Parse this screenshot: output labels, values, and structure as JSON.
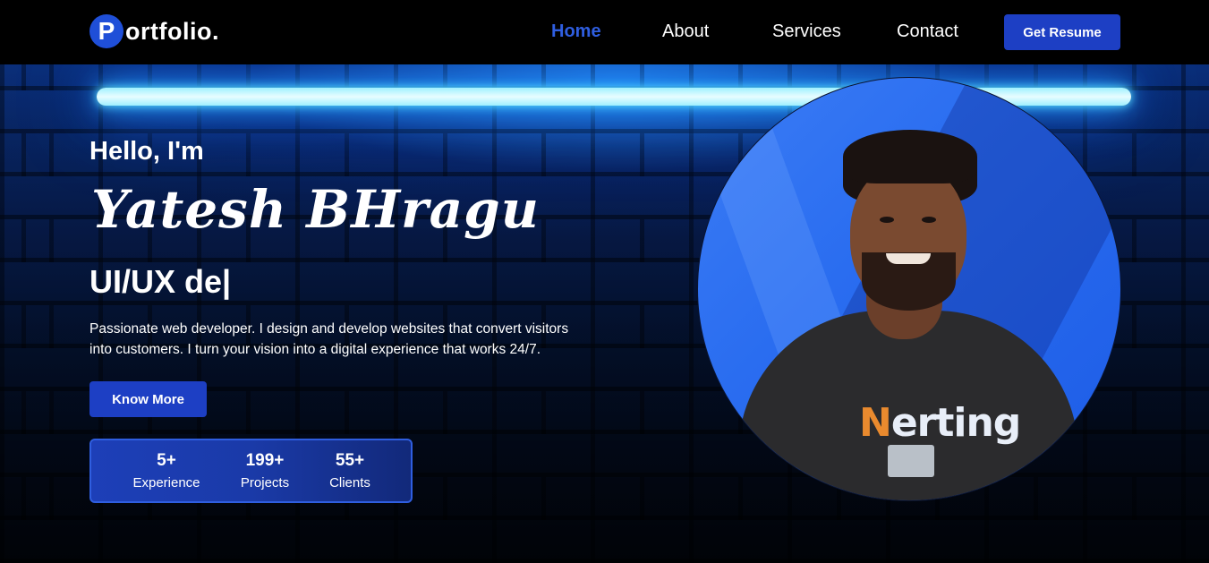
{
  "nav": {
    "logo_letter": "P",
    "logo_text": "ortfolio.",
    "links": [
      "Home",
      "About",
      "Services",
      "Contact"
    ],
    "active": "Home",
    "resume_label": "Get Resume"
  },
  "hero": {
    "greeting": "Hello, I'm",
    "name": "Yatesh BHragu",
    "role": "UI/UX de|",
    "description": "Passionate web developer. I design and develop websites that convert visitors into customers. I turn your vision into a digital experience that works 24/7.",
    "cta_label": "Know More",
    "stats": [
      {
        "value": "5+",
        "label": "Experience"
      },
      {
        "value": "199+",
        "label": "Projects"
      },
      {
        "value": "55+",
        "label": "Clients"
      }
    ]
  },
  "portrait": {
    "shirt_text_first": "N",
    "shirt_text_rest": "erting"
  },
  "colors": {
    "accent": "#1d3fc4",
    "active_link": "#2f5ee0",
    "neon": "#9ff0ff"
  }
}
